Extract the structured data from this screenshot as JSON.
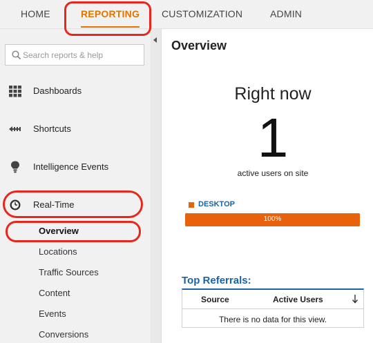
{
  "top_nav": {
    "tabs": [
      {
        "label": "HOME"
      },
      {
        "label": "REPORTING",
        "active": true
      },
      {
        "label": "CUSTOMIZATION"
      },
      {
        "label": "ADMIN"
      }
    ]
  },
  "sidebar": {
    "search_placeholder": "Search reports & help",
    "items": [
      {
        "label": "Dashboards",
        "icon": "grid-icon"
      },
      {
        "label": "Shortcuts",
        "icon": "shortcut-arrow-icon"
      },
      {
        "label": "Intelligence Events",
        "icon": "lightbulb-icon"
      },
      {
        "label": "Real-Time",
        "icon": "clock-icon"
      }
    ],
    "realtime_subitems": [
      {
        "label": "Overview",
        "active": true
      },
      {
        "label": "Locations"
      },
      {
        "label": "Traffic Sources"
      },
      {
        "label": "Content"
      },
      {
        "label": "Events"
      },
      {
        "label": "Conversions"
      }
    ]
  },
  "main": {
    "title": "Overview",
    "right_now": {
      "heading": "Right now",
      "count": "1",
      "subtitle": "active users on site"
    },
    "device_breakdown": {
      "legend_label": "DESKTOP",
      "percent_text": "100%",
      "fraction": 1.0,
      "color": "#e8620c"
    },
    "top_referrals": {
      "title": "Top Referrals:",
      "columns": [
        "Source",
        "Active Users"
      ],
      "empty_message": "There is no data for this view."
    }
  },
  "colors": {
    "accent": "#e37400",
    "link_blue": "#1a62a8",
    "highlight_ring": "#e8271c"
  }
}
